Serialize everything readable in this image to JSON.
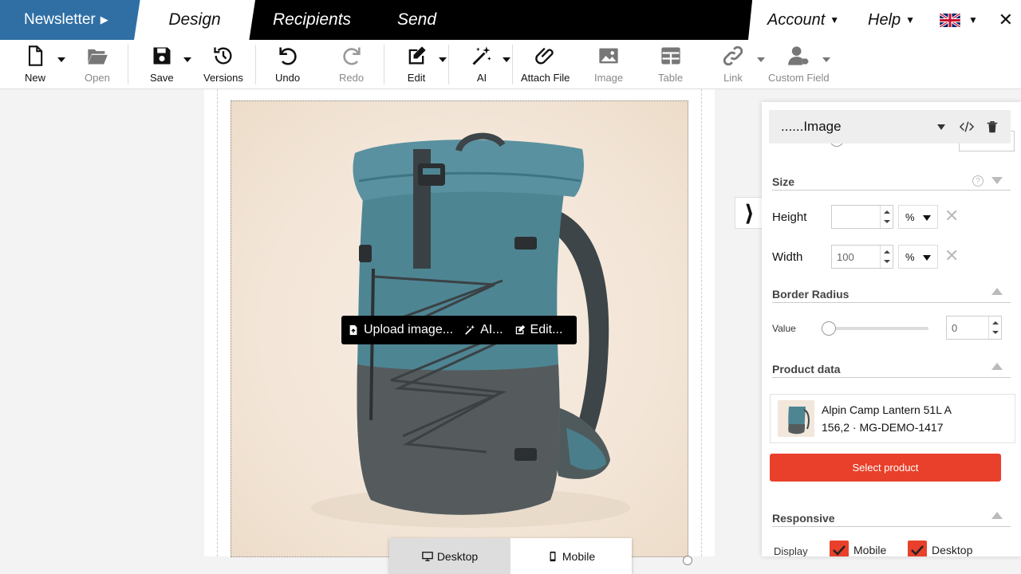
{
  "topnav": {
    "brand": "Newsletter",
    "tabs": [
      "Design",
      "Recipients",
      "Send"
    ],
    "account": "Account",
    "help": "Help",
    "close": "✕"
  },
  "toolbar": {
    "new": "New",
    "open": "Open",
    "save": "Save",
    "versions": "Versions",
    "undo": "Undo",
    "redo": "Redo",
    "edit": "Edit",
    "ai": "AI",
    "attach": "Attach File",
    "image": "Image",
    "table": "Table",
    "link": "Link",
    "custom_field": "Custom Field"
  },
  "image_overlay": {
    "upload": "Upload image...",
    "ai": "AI...",
    "edit": "Edit..."
  },
  "device": {
    "desktop": "Desktop",
    "mobile": "Mobile"
  },
  "panel": {
    "title": "......Image",
    "size": {
      "title": "Size",
      "height_label": "Height",
      "height_value": "",
      "height_unit": "%",
      "width_label": "Width",
      "width_value": "100",
      "width_unit": "%"
    },
    "border_radius": {
      "title": "Border Radius",
      "value_label": "Value",
      "value": "0",
      "slider_fraction": 0
    },
    "product": {
      "title": "Product data",
      "name": "Alpin Camp Lantern 51L A",
      "meta": "156,2 · MG-DEMO-1417",
      "select_label": "Select product"
    },
    "responsive": {
      "title": "Responsive",
      "display_label": "Display",
      "mobile_label": "Mobile",
      "desktop_label": "Desktop"
    }
  },
  "colors": {
    "brand_blue": "#2f6fa4",
    "accent_red": "#e8402a"
  }
}
